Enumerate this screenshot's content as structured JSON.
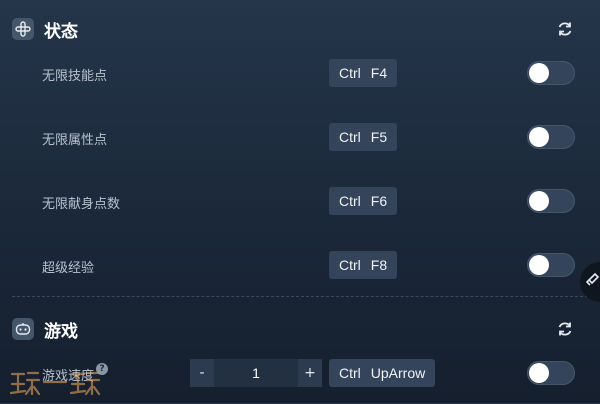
{
  "sections": [
    {
      "title": "状态",
      "icon": "plus-cross-icon",
      "rows": [
        {
          "label": "无限技能点",
          "hotkey": [
            "Ctrl",
            "F4"
          ],
          "enabled": false
        },
        {
          "label": "无限属性点",
          "hotkey": [
            "Ctrl",
            "F5"
          ],
          "enabled": false
        },
        {
          "label": "无限献身点数",
          "hotkey": [
            "Ctrl",
            "F6"
          ],
          "enabled": false
        },
        {
          "label": "超级经验",
          "hotkey": [
            "Ctrl",
            "F8"
          ],
          "enabled": false
        }
      ]
    },
    {
      "title": "游戏",
      "icon": "gamepad-icon",
      "rows": [
        {
          "label": "游戏速度",
          "has_help": true,
          "stepper": {
            "minus": "-",
            "value": "1",
            "plus": "+"
          },
          "hotkey": [
            "Ctrl",
            "UpArrow"
          ],
          "enabled": false
        }
      ]
    }
  ],
  "help_glyph": "?",
  "watermark": "玩一玩",
  "colors": {
    "background_top": "#25354a",
    "background_bottom": "#151f2e",
    "hotkey_bg": "#34445a",
    "toggle_off": "#34445a",
    "label": "#b8c2cf"
  }
}
